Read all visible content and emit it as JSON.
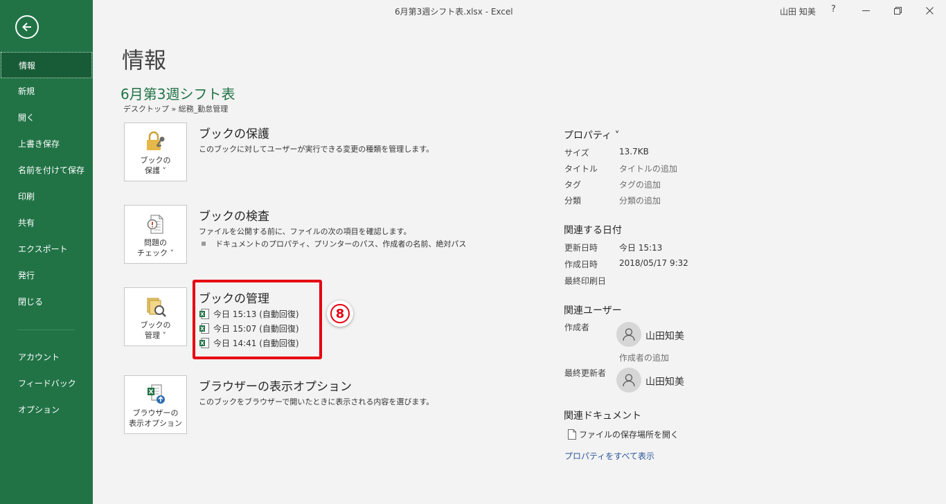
{
  "window": {
    "title": "6月第3週シフト表.xlsx  -  Excel",
    "user": "山田 知美",
    "help": "?"
  },
  "sidebar": {
    "items": [
      {
        "label": "情報",
        "active": true
      },
      {
        "label": "新規"
      },
      {
        "label": "開く"
      },
      {
        "label": "上書き保存"
      },
      {
        "label": "名前を付けて保存"
      },
      {
        "label": "印刷"
      },
      {
        "label": "共有"
      },
      {
        "label": "エクスポート"
      },
      {
        "label": "発行"
      },
      {
        "label": "閉じる"
      }
    ],
    "bottom_items": [
      {
        "label": "アカウント"
      },
      {
        "label": "フィードバック"
      },
      {
        "label": "オプション"
      }
    ]
  },
  "main": {
    "page_title": "情報",
    "file_name": "6月第3週シフト表",
    "file_path": "デスクトップ » 総務_勤怠管理",
    "protect": {
      "button_line1": "ブックの",
      "button_line2": "保護 ˅",
      "title": "ブックの保護",
      "desc": "このブックに対してユーザーが実行できる変更の種類を管理します。"
    },
    "inspect": {
      "button_line1": "問題の",
      "button_line2": "チェック ˅",
      "title": "ブックの検査",
      "desc": "ファイルを公開する前に、ファイルの次の項目を確認します。",
      "bullet": "ドキュメントのプロパティ、プリンターのパス、作成者の名前、絶対パス"
    },
    "manage": {
      "button_line1": "ブックの",
      "button_line2": "管理 ˅",
      "title": "ブックの管理",
      "versions": [
        "今日 15:13 (自動回復)",
        "今日 15:07 (自動回復)",
        "今日 14:41 (自動回復)"
      ]
    },
    "browser": {
      "button_line1": "ブラウザーの",
      "button_line2": "表示オプション",
      "title": "ブラウザーの表示オプション",
      "desc": "このブックをブラウザーで開いたときに表示される内容を選びます。"
    },
    "step_number": "8"
  },
  "properties": {
    "heading": "プロパティ ˅",
    "size_label": "サイズ",
    "size_value": "13.7KB",
    "title_label": "タイトル",
    "title_placeholder": "タイトルの追加",
    "tag_label": "タグ",
    "tag_placeholder": "タグの追加",
    "category_label": "分類",
    "category_placeholder": "分類の追加",
    "dates_heading": "関連する日付",
    "modified_label": "更新日時",
    "modified_value": "今日 15:13",
    "created_label": "作成日時",
    "created_value": "2018/05/17 9:32",
    "printed_label": "最終印刷日",
    "people_heading": "関連ユーザー",
    "author_label": "作成者",
    "author_name": "山田知美",
    "add_author": "作成者の追加",
    "last_modified_by_label": "最終更新者",
    "last_modified_by_name": "山田知美",
    "docs_heading": "関連ドキュメント",
    "open_location": "ファイルの保存場所を開く",
    "show_all": "プロパティをすべて表示"
  },
  "colors": {
    "sidebar": "#217346",
    "sidebar_active": "#185c37",
    "highlight": "#e60012",
    "link": "#2b579a"
  }
}
